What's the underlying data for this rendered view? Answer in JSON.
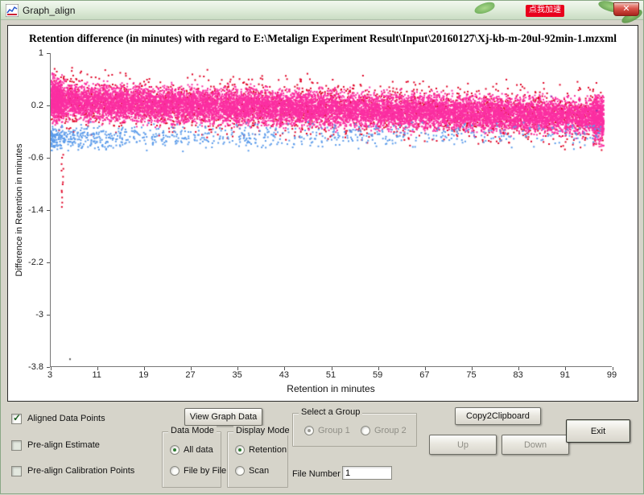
{
  "window": {
    "title": "Graph_align",
    "close_glyph": "✕",
    "ad_badge": "点我加速"
  },
  "chart": {
    "title": "Retention difference (in minutes) with regard to E:\\Metalign Experiment Result\\Input\\20160127\\Xj-kb-m-20ul-92min-1.mzxml",
    "xlabel": "Retention in minutes",
    "ylabel": "Difference in Retention in minutes"
  },
  "chart_data": {
    "type": "scatter",
    "title": "Retention difference (in minutes) with regard to E:\\Metalign Experiment Result\\Input\\20160127\\Xj-kb-m-20ul-92min-1.mzxml",
    "xlabel": "Retention in minutes",
    "ylabel": "Difference in Retention in minutes",
    "xlim": [
      3,
      99
    ],
    "ylim": [
      -3.8,
      1
    ],
    "x_ticks": [
      3,
      11,
      19,
      27,
      35,
      43,
      51,
      59,
      67,
      75,
      83,
      91,
      99
    ],
    "y_ticks": [
      1,
      0.2,
      -0.6,
      -1.4,
      -2.2,
      -3,
      -3.8
    ],
    "grid": false,
    "legend": "none",
    "series": [
      {
        "name": "outlier-red",
        "color": "#e00024",
        "n": 2600,
        "xmin": 3,
        "xmax": 97.5,
        "center_start": 0.27,
        "center_end": 0.02,
        "spread": 0.2,
        "ymax": 0.85,
        "ymin": -0.75
      },
      {
        "name": "aligned-pink",
        "color": "#fb2fa2",
        "n": 12000,
        "xmin": 3,
        "xmax": 97.5,
        "center_start": 0.26,
        "center_end": 0.02,
        "spread": 0.125,
        "ymax": 0.8,
        "ymin": -0.55
      },
      {
        "name": "left-edge-cluster-pink",
        "color": "#fb2fa2",
        "n": 320,
        "xmin": 3,
        "xmax": 5,
        "center_start": 0.3,
        "center_end": 0.28,
        "spread": 0.17,
        "ymax": 0.72,
        "ymin": -0.3
      },
      {
        "name": "right-edge-cluster-pink",
        "color": "#fb2fa2",
        "n": 260,
        "xmin": 95.5,
        "xmax": 97.5,
        "center_start": 0.0,
        "center_end": -0.05,
        "spread": 0.18,
        "ymax": 0.4,
        "ymin": -0.5
      },
      {
        "name": "prealign-blue",
        "color": "#5b9bea",
        "n": 850,
        "xmin": 3,
        "xmax": 97,
        "center_start": -0.3,
        "center_end": -0.22,
        "spread": 0.09,
        "bias": 1.9,
        "ymax": -0.05,
        "ymin": -0.62
      }
    ],
    "red_trail": {
      "x": 5.0,
      "y_top": -0.55,
      "y_bottom": -1.35,
      "n": 13,
      "color": "#e00024"
    },
    "extra_points": [
      {
        "x": 88.5,
        "y": 0.34,
        "color": "#8b2fb0"
      },
      {
        "x": 96.3,
        "y": 0.12,
        "color": "#8b2fb0"
      },
      {
        "x": 6.3,
        "y": -3.68,
        "color": "#555555"
      }
    ]
  },
  "controls": {
    "check_glyph": "✓",
    "checkboxes": [
      {
        "label": "Aligned Data Points",
        "checked": true
      },
      {
        "label": "Pre-align Estimate",
        "checked": false
      },
      {
        "label": "Pre-align Calibration Points",
        "checked": false
      }
    ],
    "view_graph_data_label": "View Graph Data",
    "data_mode": {
      "legend": "Data Mode",
      "options": [
        {
          "label": "All data",
          "selected": true
        },
        {
          "label": "File by File",
          "selected": false
        }
      ]
    },
    "display_mode": {
      "legend": "Display Mode",
      "options": [
        {
          "label": "Retention",
          "selected": true
        },
        {
          "label": "Scan",
          "selected": false
        }
      ]
    },
    "select_group": {
      "legend": "Select a Group",
      "options": [
        {
          "label": "Group 1",
          "selected": true
        },
        {
          "label": "Group 2",
          "selected": false
        }
      ]
    },
    "file_number_label": "File Number",
    "file_number_value": "1",
    "copy2clipboard_label": "Copy2Clipboard",
    "up_label": "Up",
    "down_label": "Down",
    "exit_label": "Exit"
  }
}
